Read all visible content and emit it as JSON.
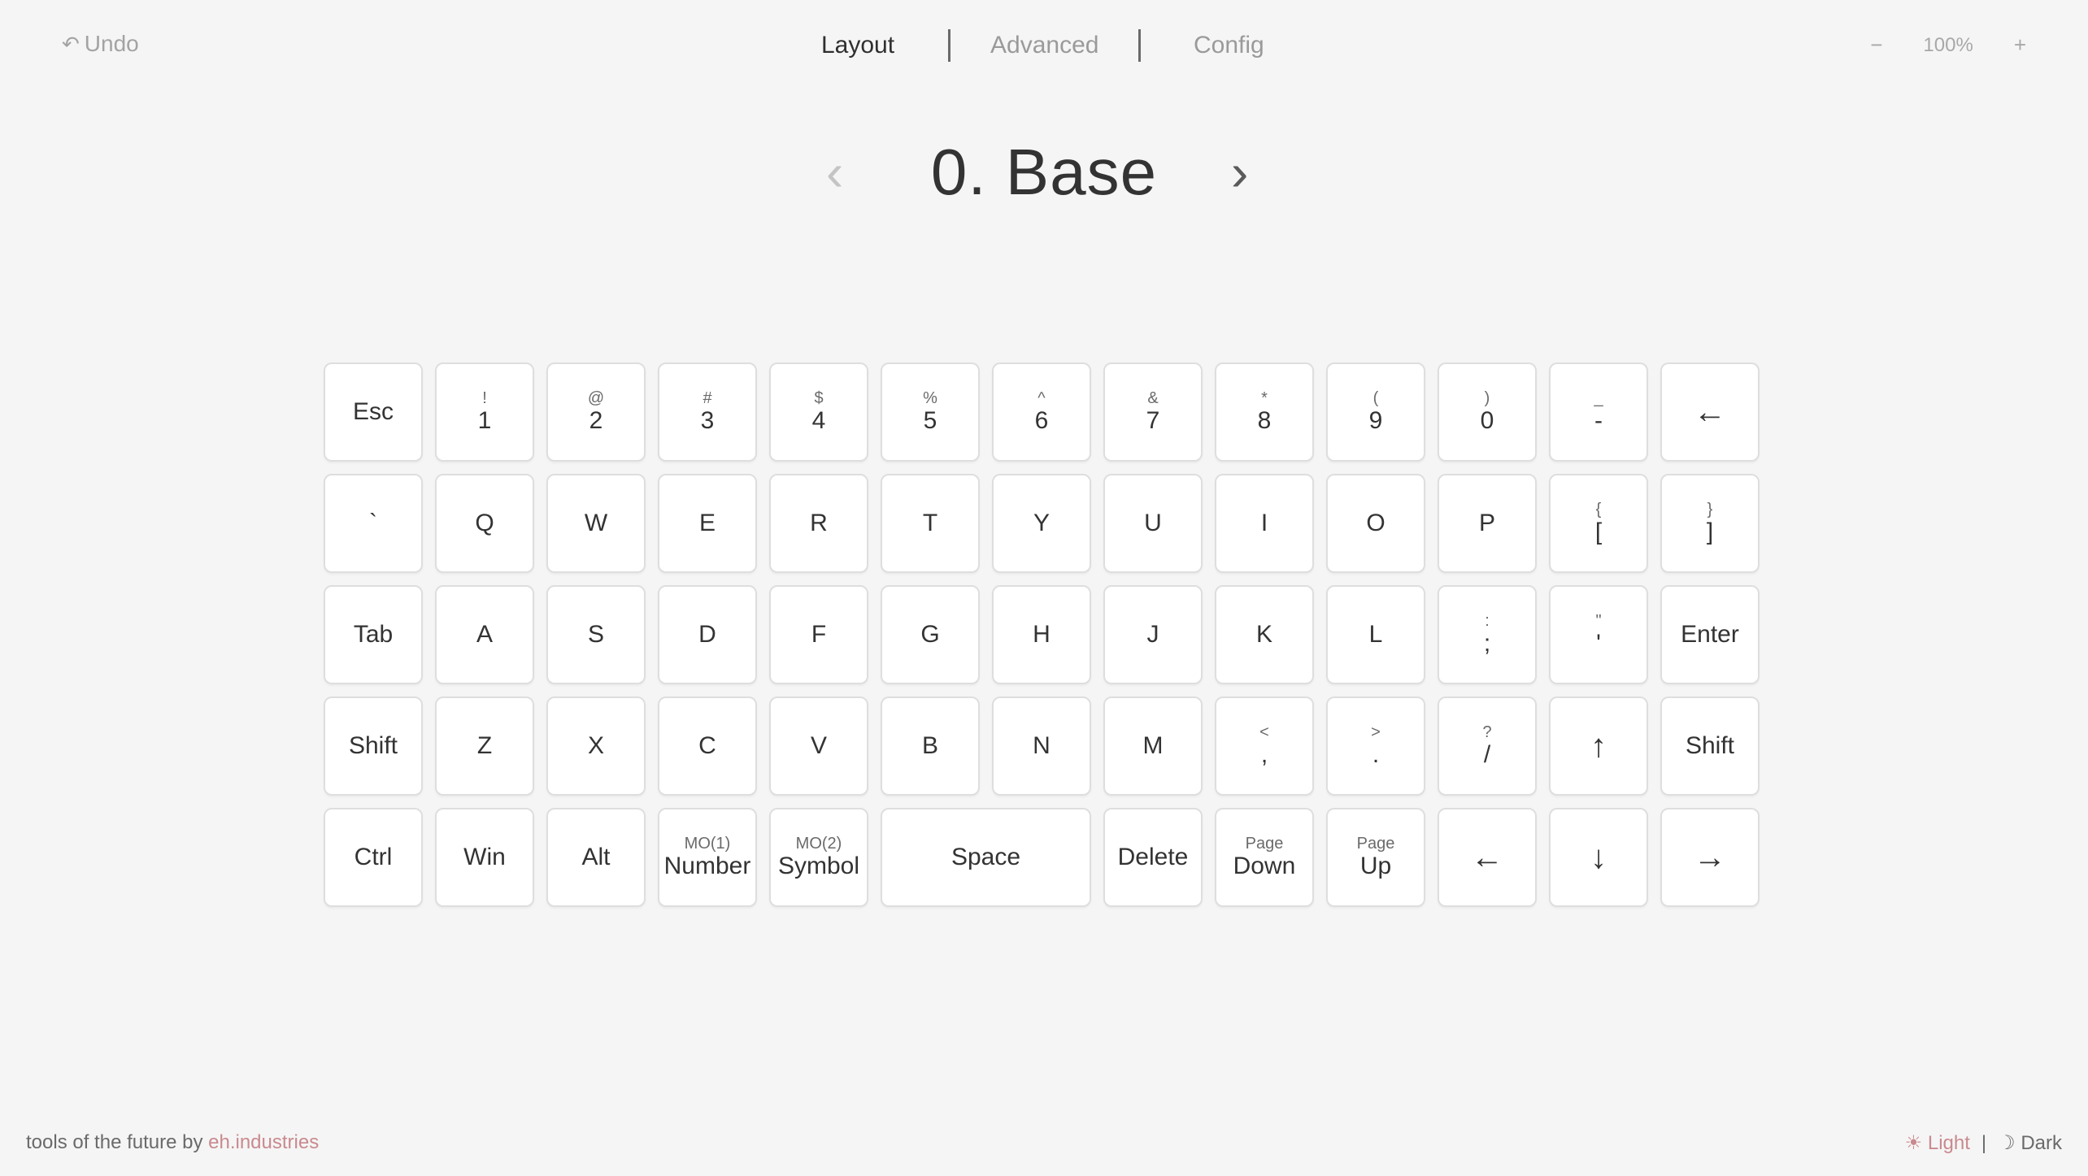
{
  "header": {
    "undo_icon": "↶",
    "undo_label": "Undo",
    "tabs": [
      {
        "label": "Layout",
        "active": true
      },
      {
        "label": "Advanced",
        "active": false
      },
      {
        "label": "Config",
        "active": false
      }
    ],
    "zoom": {
      "minus": "−",
      "value": "100%",
      "plus": "+"
    }
  },
  "layer": {
    "prev": "‹",
    "title": "0. Base",
    "next": "›"
  },
  "keyboard": {
    "rows": [
      [
        {
          "sub": "",
          "main": "Esc"
        },
        {
          "sub": "!",
          "main": "1"
        },
        {
          "sub": "@",
          "main": "2"
        },
        {
          "sub": "#",
          "main": "3"
        },
        {
          "sub": "$",
          "main": "4"
        },
        {
          "sub": "%",
          "main": "5"
        },
        {
          "sub": "^",
          "main": "6"
        },
        {
          "sub": "&",
          "main": "7"
        },
        {
          "sub": "*",
          "main": "8"
        },
        {
          "sub": "(",
          "main": "9"
        },
        {
          "sub": ")",
          "main": "0"
        },
        {
          "sub": "_",
          "main": "-"
        },
        {
          "sub": "",
          "main": "←"
        }
      ],
      [
        {
          "sub": "",
          "main": "`"
        },
        {
          "sub": "",
          "main": "Q"
        },
        {
          "sub": "",
          "main": "W"
        },
        {
          "sub": "",
          "main": "E"
        },
        {
          "sub": "",
          "main": "R"
        },
        {
          "sub": "",
          "main": "T"
        },
        {
          "sub": "",
          "main": "Y"
        },
        {
          "sub": "",
          "main": "U"
        },
        {
          "sub": "",
          "main": "I"
        },
        {
          "sub": "",
          "main": "O"
        },
        {
          "sub": "",
          "main": "P"
        },
        {
          "sub": "{",
          "main": "["
        },
        {
          "sub": "}",
          "main": "]"
        }
      ],
      [
        {
          "sub": "",
          "main": "Tab"
        },
        {
          "sub": "",
          "main": "A"
        },
        {
          "sub": "",
          "main": "S"
        },
        {
          "sub": "",
          "main": "D"
        },
        {
          "sub": "",
          "main": "F"
        },
        {
          "sub": "",
          "main": "G"
        },
        {
          "sub": "",
          "main": "H"
        },
        {
          "sub": "",
          "main": "J"
        },
        {
          "sub": "",
          "main": "K"
        },
        {
          "sub": "",
          "main": "L"
        },
        {
          "sub": ":",
          "main": ";"
        },
        {
          "sub": "\"",
          "main": "'"
        },
        {
          "sub": "",
          "main": "Enter"
        }
      ],
      [
        {
          "sub": "",
          "main": "Shift"
        },
        {
          "sub": "",
          "main": "Z"
        },
        {
          "sub": "",
          "main": "X"
        },
        {
          "sub": "",
          "main": "C"
        },
        {
          "sub": "",
          "main": "V"
        },
        {
          "sub": "",
          "main": "B"
        },
        {
          "sub": "",
          "main": "N"
        },
        {
          "sub": "",
          "main": "M"
        },
        {
          "sub": "<",
          "main": ","
        },
        {
          "sub": ">",
          "main": "."
        },
        {
          "sub": "?",
          "main": "/"
        },
        {
          "sub": "",
          "main": "↑"
        },
        {
          "sub": "",
          "main": "Shift"
        }
      ],
      [
        {
          "sub": "",
          "main": "Ctrl"
        },
        {
          "sub": "",
          "main": "Win"
        },
        {
          "sub": "",
          "main": "Alt"
        },
        {
          "sub": "MO(1)",
          "main": "Number"
        },
        {
          "sub": "MO(2)",
          "main": "Symbol"
        },
        {
          "sub": "",
          "main": "Space",
          "wide": true
        },
        {
          "sub": "",
          "main": "Delete"
        },
        {
          "sub": "Page",
          "main": "Down"
        },
        {
          "sub": "Page",
          "main": "Up"
        },
        {
          "sub": "",
          "main": "←"
        },
        {
          "sub": "",
          "main": "↓"
        },
        {
          "sub": "",
          "main": "→"
        }
      ]
    ]
  },
  "footer": {
    "prefix": "tools of the future by ",
    "link": "eh.industries",
    "light_icon": "☀",
    "light_label": "Light",
    "separator": "|",
    "dark_icon": "☽",
    "dark_label": "Dark"
  },
  "colors": {
    "background": "#f5f5f5",
    "key_border": "#dedede",
    "accent": "#c98a8f",
    "text": "#333333",
    "muted": "#9a9a9a"
  }
}
